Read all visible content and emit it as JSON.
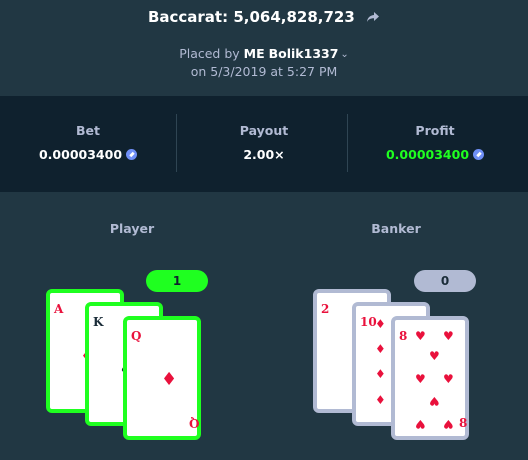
{
  "header": {
    "game": "Baccarat",
    "bet_id": "5,064,828,723",
    "title": "Baccarat: 5,064,828,723",
    "placed_by_prefix": "Placed by",
    "user_prefix": "ME",
    "username": "Bolik1337",
    "placed_on": "on 5/3/2019 at 5:27 PM"
  },
  "stats": {
    "bet_label": "Bet",
    "bet_value": "0.00003400",
    "payout_label": "Payout",
    "payout_value": "2.00×",
    "profit_label": "Profit",
    "profit_value": "0.00003400"
  },
  "player": {
    "title": "Player",
    "score": "1",
    "cards": [
      {
        "rank": "A",
        "suit": "diamond"
      },
      {
        "rank": "K",
        "suit": "spade"
      },
      {
        "rank": "Q",
        "suit": "diamond"
      }
    ]
  },
  "banker": {
    "title": "Banker",
    "score": "0",
    "cards": [
      {
        "rank": "2",
        "suit": "diamond"
      },
      {
        "rank": "10",
        "suit": "diamond"
      },
      {
        "rank": "8",
        "suit": "heart"
      }
    ]
  },
  "colors": {
    "background": "#213743",
    "stats_background": "#0f212e",
    "win_green": "#1fff20",
    "lose_grey": "#b1bad3",
    "suit_red": "#e9113c",
    "currency_icon": "#6f8ff7"
  },
  "icons": {
    "share": "share-arrow-icon",
    "dropdown": "chevron-down-icon",
    "currency": "ethereum-coin-icon"
  }
}
